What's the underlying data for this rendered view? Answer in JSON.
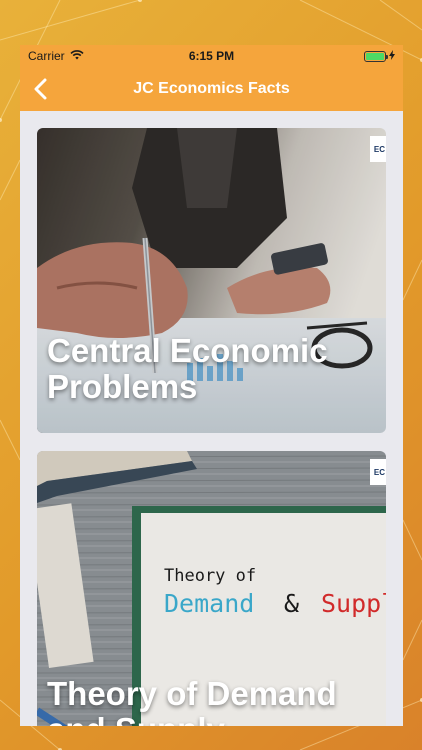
{
  "status_bar": {
    "carrier": "Carrier",
    "time": "6:15 PM",
    "charging_icon": "bolt-icon",
    "wifi_icon": "wifi-icon",
    "battery_level": 1.0
  },
  "nav": {
    "title": "JC Economics Facts",
    "back_icon": "chevron-left-icon"
  },
  "colors": {
    "nav_bg": "#f5a53c",
    "background": "#e29a2a",
    "feed_bg": "#e9e9ee",
    "title_text": "#ffffff"
  },
  "cards": [
    {
      "title": "Central Economic Problems",
      "badge": "EC"
    },
    {
      "title": "Theory of Demand and Supply",
      "badge": "EC",
      "board_line1": "Theory of",
      "board_word_demand": "Demand",
      "board_amp": "&",
      "board_word_supply": "Suppl"
    }
  ]
}
